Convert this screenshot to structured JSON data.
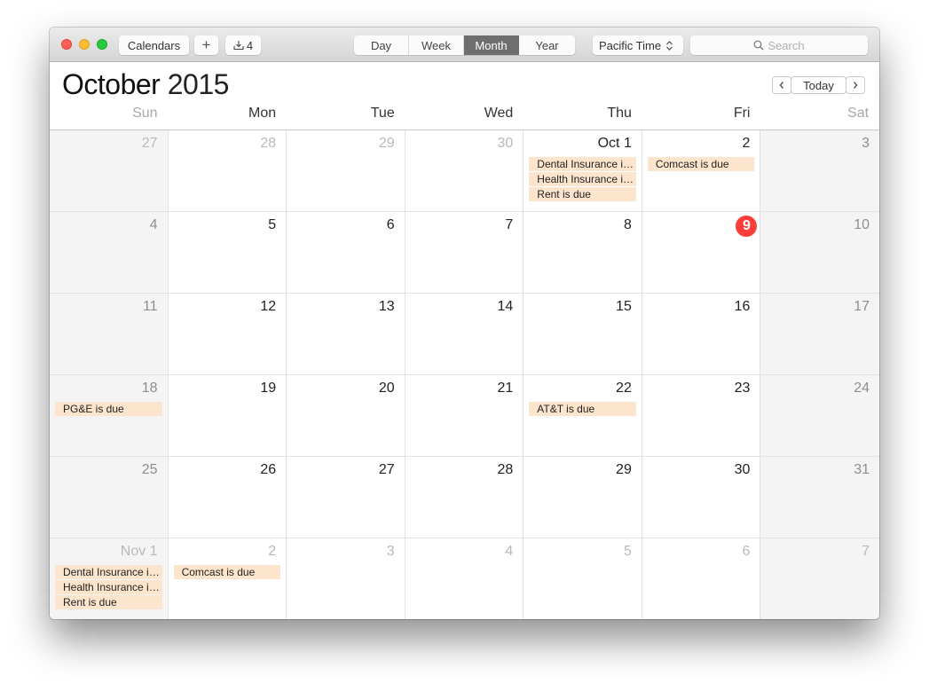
{
  "window": {
    "traffic_lights": [
      "close",
      "minimize",
      "zoom"
    ]
  },
  "toolbar": {
    "calendars_label": "Calendars",
    "add_label": "+",
    "inbox_count": "4",
    "views": [
      {
        "label": "Day",
        "active": false
      },
      {
        "label": "Week",
        "active": false
      },
      {
        "label": "Month",
        "active": true
      },
      {
        "label": "Year",
        "active": false
      }
    ],
    "timezone": "Pacific Time",
    "search_placeholder": "Search"
  },
  "header": {
    "month": "October",
    "year": "2015",
    "prev_label": "<",
    "today_label": "Today",
    "next_label": ">"
  },
  "weekdays": [
    "Sun",
    "Mon",
    "Tue",
    "Wed",
    "Thu",
    "Fri",
    "Sat"
  ],
  "weeks": [
    [
      {
        "label": "27",
        "other": true,
        "events": []
      },
      {
        "label": "28",
        "other": true,
        "events": []
      },
      {
        "label": "29",
        "other": true,
        "events": []
      },
      {
        "label": "30",
        "other": true,
        "events": []
      },
      {
        "label": "Oct 1",
        "other": false,
        "events": [
          "Dental Insurance is due",
          "Health Insurance is due",
          "Rent is due"
        ]
      },
      {
        "label": "2",
        "other": false,
        "events": [
          "Comcast is due"
        ]
      },
      {
        "label": "3",
        "other": false,
        "events": []
      }
    ],
    [
      {
        "label": "4",
        "other": false,
        "events": []
      },
      {
        "label": "5",
        "other": false,
        "events": []
      },
      {
        "label": "6",
        "other": false,
        "events": []
      },
      {
        "label": "7",
        "other": false,
        "events": []
      },
      {
        "label": "8",
        "other": false,
        "events": []
      },
      {
        "label": "9",
        "other": false,
        "today": true,
        "events": []
      },
      {
        "label": "10",
        "other": false,
        "events": []
      }
    ],
    [
      {
        "label": "11",
        "other": false,
        "events": []
      },
      {
        "label": "12",
        "other": false,
        "events": []
      },
      {
        "label": "13",
        "other": false,
        "events": []
      },
      {
        "label": "14",
        "other": false,
        "events": []
      },
      {
        "label": "15",
        "other": false,
        "events": []
      },
      {
        "label": "16",
        "other": false,
        "events": []
      },
      {
        "label": "17",
        "other": false,
        "events": []
      }
    ],
    [
      {
        "label": "18",
        "other": false,
        "events": [
          "PG&E is due"
        ]
      },
      {
        "label": "19",
        "other": false,
        "events": []
      },
      {
        "label": "20",
        "other": false,
        "events": []
      },
      {
        "label": "21",
        "other": false,
        "events": []
      },
      {
        "label": "22",
        "other": false,
        "events": [
          "AT&T is due"
        ]
      },
      {
        "label": "23",
        "other": false,
        "events": []
      },
      {
        "label": "24",
        "other": false,
        "events": []
      }
    ],
    [
      {
        "label": "25",
        "other": false,
        "events": []
      },
      {
        "label": "26",
        "other": false,
        "events": []
      },
      {
        "label": "27",
        "other": false,
        "events": []
      },
      {
        "label": "28",
        "other": false,
        "events": []
      },
      {
        "label": "29",
        "other": false,
        "events": []
      },
      {
        "label": "30",
        "other": false,
        "events": []
      },
      {
        "label": "31",
        "other": false,
        "events": []
      }
    ],
    [
      {
        "label": "Nov 1",
        "other": true,
        "events": [
          "Dental Insurance is due",
          "Health Insurance is due",
          "Rent is due"
        ]
      },
      {
        "label": "2",
        "other": true,
        "events": [
          "Comcast is due"
        ]
      },
      {
        "label": "3",
        "other": true,
        "events": []
      },
      {
        "label": "4",
        "other": true,
        "events": []
      },
      {
        "label": "5",
        "other": true,
        "events": []
      },
      {
        "label": "6",
        "other": true,
        "events": []
      },
      {
        "label": "7",
        "other": true,
        "events": []
      }
    ]
  ],
  "colors": {
    "event_bg": "#fde4cc",
    "today_badge": "#fc3d39",
    "active_view_bg": "#6e6e6e"
  }
}
